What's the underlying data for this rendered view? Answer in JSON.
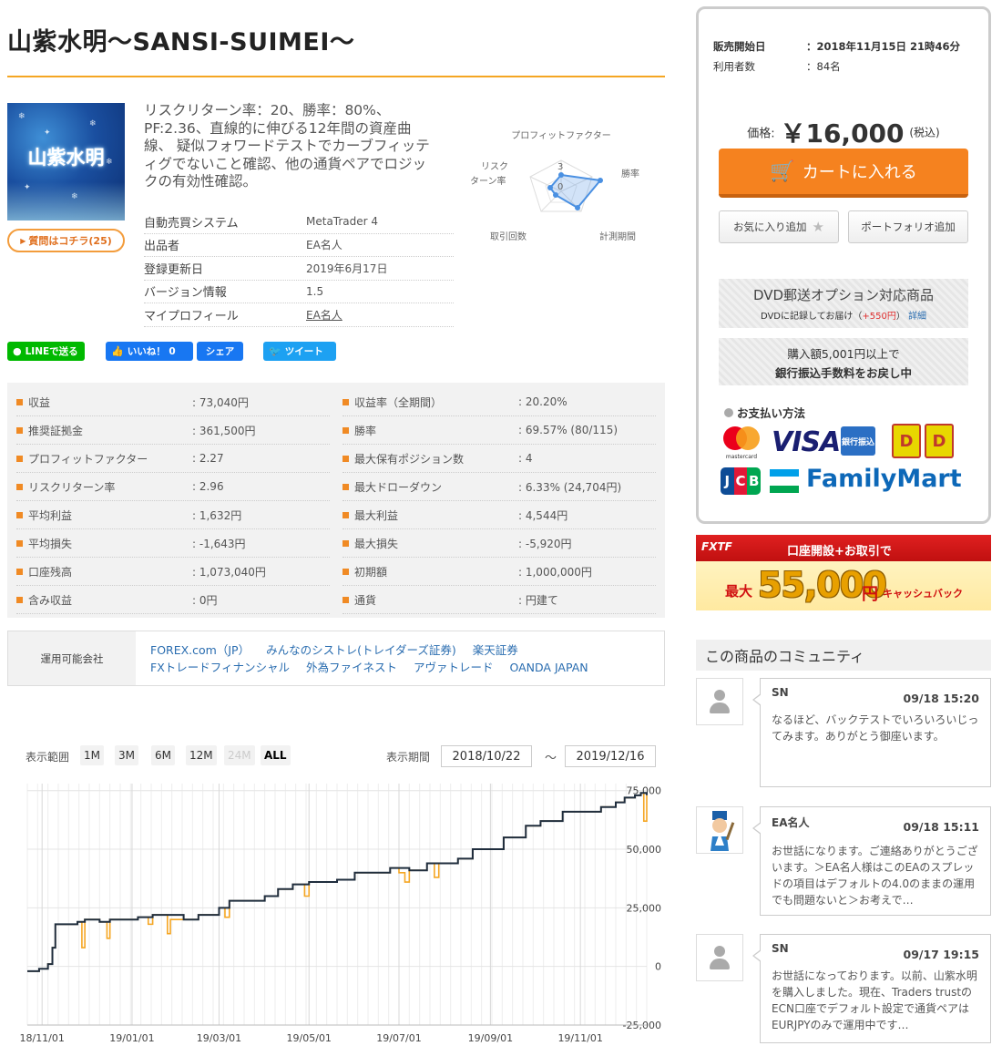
{
  "product": {
    "title": "山紫水明～SANSI-SUIMEI～",
    "thumbnail_text": "山紫水明",
    "question_button": "質問はコチラ(25)",
    "description": "リスクリターン率：20、勝率：80%、PF:2.36、直線的に伸びる12年間の資産曲線、 疑似フォワードテストでカーブフィッティグでないこと確認、他の通貨ペアでロジックの有効性確認。",
    "info": [
      {
        "label": "自動売買システム",
        "value": "MetaTrader 4"
      },
      {
        "label": "出品者",
        "value": "EA名人"
      },
      {
        "label": "登録更新日",
        "value": "2019年6月17日"
      },
      {
        "label": "バージョン情報",
        "value": "1.5"
      },
      {
        "label": "マイプロフィール",
        "value": "EA名人"
      }
    ]
  },
  "radar": {
    "labels": {
      "top": "プロフィットファクター",
      "right": "勝率",
      "bottom_right": "計測期間",
      "bottom_left": "取引回数",
      "left": "リスクターン率"
    },
    "left_line1": "リスク",
    "left_line2": "ターン率",
    "center_label": "0",
    "top_label": "3"
  },
  "social": {
    "line": "LINEで送る",
    "like": "いいね！ 0",
    "share": "シェア",
    "tweet": "ツイート"
  },
  "stats_left": [
    {
      "label": "収益",
      "value": ": 73,040円"
    },
    {
      "label": "推奨証拠金",
      "value": ": 361,500円"
    },
    {
      "label": "プロフィットファクター",
      "value": ": 2.27"
    },
    {
      "label": "リスクリターン率",
      "value": ": 2.96"
    },
    {
      "label": "平均利益",
      "value": ": 1,632円"
    },
    {
      "label": "平均損失",
      "value": ": -1,643円"
    },
    {
      "label": "口座残高",
      "value": ": 1,073,040円"
    },
    {
      "label": "含み収益",
      "value": ": 0円"
    }
  ],
  "stats_right": [
    {
      "label": "収益率（全期間）",
      "value": ": 20.20%"
    },
    {
      "label": "勝率",
      "value": ": 69.57% (80/115)"
    },
    {
      "label": "最大保有ポジション数",
      "value": ": 4"
    },
    {
      "label": "最大ドローダウン",
      "value": ": 6.33% (24,704円)"
    },
    {
      "label": "最大利益",
      "value": ": 4,544円"
    },
    {
      "label": "最大損失",
      "value": ": -5,920円"
    },
    {
      "label": "初期額",
      "value": ": 1,000,000円"
    },
    {
      "label": "通貨",
      "value": ": 円建て"
    }
  ],
  "brokers": {
    "label": "運用可能会社",
    "row1": [
      "FOREX.com（JP）",
      "みんなのシストレ(トレイダーズ証券)",
      "楽天証券"
    ],
    "row2": [
      "FXトレードフィナンシャル",
      "外為ファイネスト",
      "アヴァトレード",
      "OANDA JAPAN"
    ]
  },
  "range": {
    "label": "表示範囲",
    "buttons": [
      "1M",
      "3M",
      "6M",
      "12M",
      "24M",
      "ALL"
    ],
    "period_label": "表示期間",
    "from": "2018/10/22",
    "tilde": "～",
    "to": "2019/12/16"
  },
  "chart_data": {
    "type": "line",
    "x_ticks": [
      "18/11/01",
      "19/01/01",
      "19/03/01",
      "19/05/01",
      "19/07/01",
      "19/09/01",
      "19/11/01"
    ],
    "y_ticks": [
      "75,000",
      "50,000",
      "25,000",
      "0",
      "-25,000"
    ],
    "ylim": [
      -25000,
      78000
    ],
    "x_start": "2018-10-22",
    "x_end": "2019-12-16",
    "series": [
      {
        "color": "#f5a623",
        "values": [
          [
            "2018-10-22",
            -2000
          ],
          [
            "2018-10-30",
            -1000
          ],
          [
            "2018-11-05",
            1000
          ],
          [
            "2018-11-08",
            8000
          ],
          [
            "2018-11-10",
            18000
          ],
          [
            "2018-11-25",
            19000
          ],
          [
            "2018-11-28",
            8000
          ],
          [
            "2018-11-30",
            20000
          ],
          [
            "2018-12-10",
            19000
          ],
          [
            "2018-12-15",
            12000
          ],
          [
            "2018-12-17",
            20000
          ],
          [
            "2019-01-05",
            21000
          ],
          [
            "2019-01-12",
            18000
          ],
          [
            "2019-01-15",
            22000
          ],
          [
            "2019-01-22",
            22000
          ],
          [
            "2019-01-25",
            14000
          ],
          [
            "2019-01-27",
            20000
          ],
          [
            "2019-02-05",
            20000
          ],
          [
            "2019-02-15",
            22000
          ],
          [
            "2019-02-25",
            22000
          ],
          [
            "2019-03-01",
            25000
          ],
          [
            "2019-03-05",
            21000
          ],
          [
            "2019-03-08",
            28000
          ],
          [
            "2019-03-20",
            28000
          ],
          [
            "2019-04-01",
            30000
          ],
          [
            "2019-04-10",
            33000
          ],
          [
            "2019-04-20",
            35000
          ],
          [
            "2019-04-28",
            30000
          ],
          [
            "2019-05-01",
            36000
          ],
          [
            "2019-05-20",
            37000
          ],
          [
            "2019-06-01",
            40000
          ],
          [
            "2019-06-15",
            40000
          ],
          [
            "2019-06-25",
            42000
          ],
          [
            "2019-07-01",
            40000
          ],
          [
            "2019-07-05",
            36000
          ],
          [
            "2019-07-08",
            41000
          ],
          [
            "2019-07-20",
            44000
          ],
          [
            "2019-07-25",
            38000
          ],
          [
            "2019-07-28",
            44000
          ],
          [
            "2019-08-10",
            46000
          ],
          [
            "2019-08-20",
            50000
          ],
          [
            "2019-09-01",
            50000
          ],
          [
            "2019-09-10",
            55000
          ],
          [
            "2019-09-20",
            55000
          ],
          [
            "2019-09-25",
            60000
          ],
          [
            "2019-10-05",
            62000
          ],
          [
            "2019-10-20",
            66000
          ],
          [
            "2019-11-01",
            66000
          ],
          [
            "2019-11-15",
            68000
          ],
          [
            "2019-11-25",
            70000
          ],
          [
            "2019-12-01",
            72000
          ],
          [
            "2019-12-08",
            73000
          ],
          [
            "2019-12-12",
            74000
          ],
          [
            "2019-12-14",
            62000
          ],
          [
            "2019-12-16",
            73040
          ]
        ]
      },
      {
        "color": "#1f2d3d",
        "values": [
          [
            "2018-10-22",
            -2000
          ],
          [
            "2018-10-30",
            -1000
          ],
          [
            "2018-11-05",
            1000
          ],
          [
            "2018-11-08",
            8000
          ],
          [
            "2018-11-10",
            18000
          ],
          [
            "2018-11-25",
            19000
          ],
          [
            "2018-11-30",
            20000
          ],
          [
            "2018-12-10",
            19000
          ],
          [
            "2018-12-17",
            20000
          ],
          [
            "2019-01-05",
            21000
          ],
          [
            "2019-01-15",
            22000
          ],
          [
            "2019-02-05",
            20000
          ],
          [
            "2019-02-15",
            22000
          ],
          [
            "2019-03-01",
            25000
          ],
          [
            "2019-03-08",
            28000
          ],
          [
            "2019-04-01",
            30000
          ],
          [
            "2019-04-10",
            33000
          ],
          [
            "2019-04-20",
            35000
          ],
          [
            "2019-05-01",
            36000
          ],
          [
            "2019-05-20",
            37000
          ],
          [
            "2019-06-01",
            40000
          ],
          [
            "2019-06-25",
            42000
          ],
          [
            "2019-07-08",
            41000
          ],
          [
            "2019-07-20",
            44000
          ],
          [
            "2019-08-10",
            46000
          ],
          [
            "2019-08-20",
            50000
          ],
          [
            "2019-09-10",
            55000
          ],
          [
            "2019-09-25",
            60000
          ],
          [
            "2019-10-05",
            62000
          ],
          [
            "2019-10-20",
            66000
          ],
          [
            "2019-11-15",
            68000
          ],
          [
            "2019-11-25",
            70000
          ],
          [
            "2019-12-01",
            72000
          ],
          [
            "2019-12-08",
            73000
          ],
          [
            "2019-12-12",
            74000
          ],
          [
            "2019-12-16",
            73040
          ]
        ]
      }
    ],
    "grid": true
  },
  "buy": {
    "start_label": "販売開始日",
    "start_value": "：2018年11月15日 21時46分",
    "users_label": "利用者数",
    "users_value": "：84名",
    "price_label": "価格:",
    "price_value": "￥16,000",
    "tax": "(税込)",
    "cart": "カートに入れる",
    "favorite": "お気に入り追加",
    "portfolio": "ポートフォリオ追加",
    "dvd_title": "DVD郵送オプション対応商品",
    "dvd_sub1": "DVDに記録してお届け（",
    "dvd_price": "+550円",
    "dvd_sub2": "）",
    "dvd_detail": "詳細",
    "bank1": "購入額5,001円以上で",
    "bank2": "銀行振込手数料をお戻し中",
    "pay_title": "お支払い方法",
    "visa": "VISA",
    "bank_badge": "銀行振込",
    "familymart": "FamilyMart",
    "jcb": [
      "J",
      "C",
      "B"
    ],
    "mastercard_text": "mastercard"
  },
  "fxtf": {
    "logo": "FXTF",
    "headline": "口座開設+お取引で",
    "prefix": "最大",
    "amount": "55,000",
    "unit": "円",
    "cashback": "キャッシュバック"
  },
  "community": {
    "title": "この商品のコミュニティ",
    "comments": [
      {
        "name": "SN",
        "time": "09/18 15:20",
        "text": "なるほど、バックテストでいろいろいじってみます。ありがとう御座います。"
      },
      {
        "name": "EA名人",
        "time": "09/18 15:11",
        "text": "お世話になります。ご連絡ありがとうございます。＞EA名人様はこのEAのスプレッドの項目はデフォルトの4.0のままの運用でも問題ないと＞お考えで…"
      },
      {
        "name": "SN",
        "time": "09/17 19:15",
        "text": "お世話になっております。以前、山紫水明を購入しました。現在、Traders trustのECN口座でデフォルト設定で通貨ペアはEURJPYのみで運用中です…"
      }
    ]
  }
}
